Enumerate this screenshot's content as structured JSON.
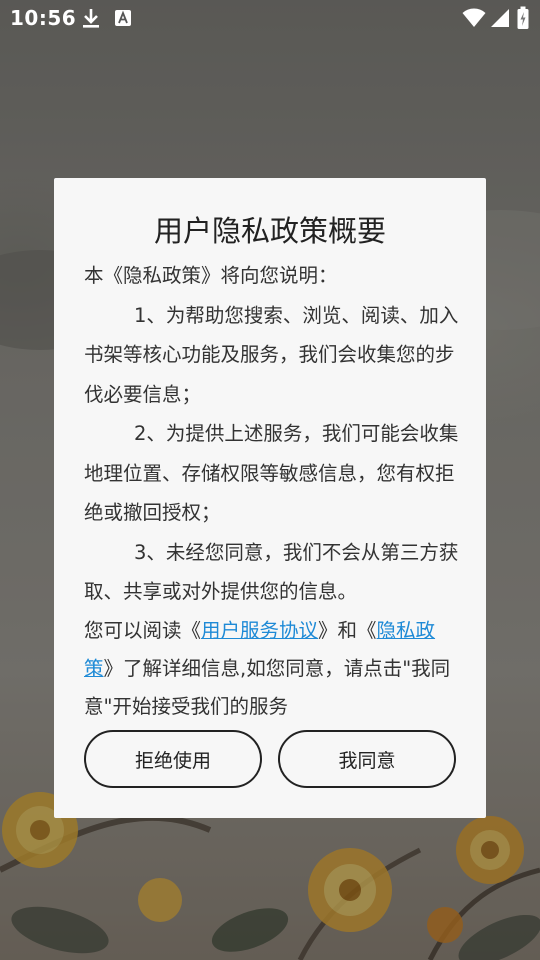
{
  "status_bar": {
    "time": "10:56"
  },
  "dialog": {
    "title": "用户隐私政策概要",
    "intro": "本《隐私政策》将向您说明：",
    "items": [
      "1、为帮助您搜索、浏览、阅读、加入书架等核心功能及服务，我们会收集您的步伐必要信息；",
      "2、为提供上述服务，我们可能会收集地理位置、存储权限等敏感信息，您有权拒绝或撤回授权；",
      "3、未经您同意，我们不会从第三方获取、共享或对外提供您的信息。"
    ],
    "notice_prefix": "您可以阅读《",
    "link_user_agreement": "用户服务协议",
    "notice_middle": "》和《",
    "link_privacy_policy": "隐私政策",
    "notice_suffix": "》了解详细信息,如您同意，请点击\"我同意\"开始接受我们的服务",
    "refuse_label": "拒绝使用",
    "agree_label": "我同意"
  },
  "colors": {
    "link": "#1e8ad6",
    "dialog_bg": "#f7f7f7",
    "button_border": "#222222"
  },
  "icons": [
    "download-icon",
    "keyboard-a-icon",
    "wifi-icon",
    "cellular-signal-icon",
    "battery-charging-icon"
  ]
}
